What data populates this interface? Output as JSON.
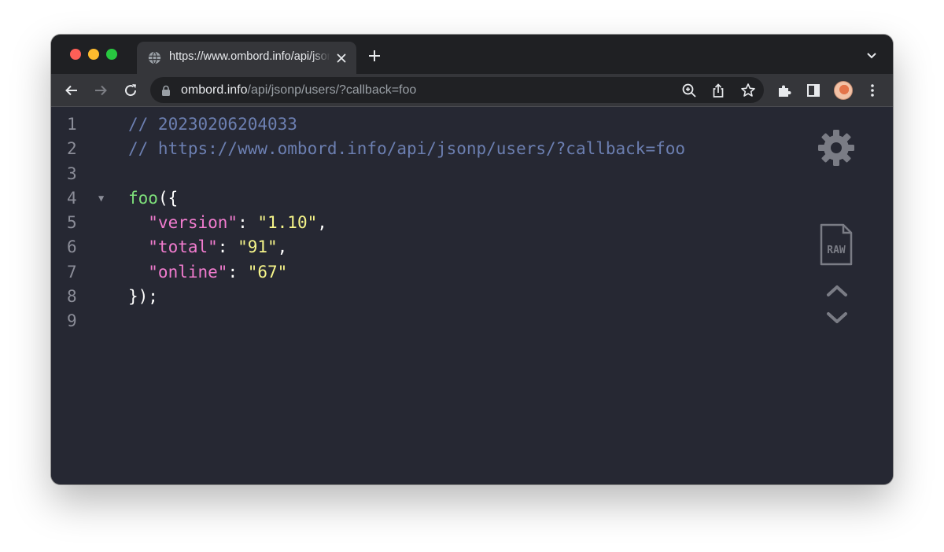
{
  "browser": {
    "tab": {
      "title": "https://www.ombord.info/api/jsonp/users/?callback=foo"
    },
    "omnibox": {
      "url_host": "ombord.info",
      "url_path": "/api/jsonp/users/?callback=foo"
    }
  },
  "viewer": {
    "lines": [
      {
        "num": "1",
        "tokens": [
          {
            "t": "// 20230206204033",
            "c": "comment"
          }
        ]
      },
      {
        "num": "2",
        "tokens": [
          {
            "t": "// https://www.ombord.info/api/jsonp/users/?callback=foo",
            "c": "comment"
          }
        ]
      },
      {
        "num": "3",
        "tokens": []
      },
      {
        "num": "4",
        "fold": "▼",
        "tokens": [
          {
            "t": "foo",
            "c": "func"
          },
          {
            "t": "({",
            "c": "punct"
          }
        ]
      },
      {
        "num": "5",
        "tokens": [
          {
            "t": "  \"version\"",
            "c": "key"
          },
          {
            "t": ": ",
            "c": "punct"
          },
          {
            "t": "\"1.10\"",
            "c": "str"
          },
          {
            "t": ",",
            "c": "punct"
          }
        ]
      },
      {
        "num": "6",
        "tokens": [
          {
            "t": "  \"total\"",
            "c": "key"
          },
          {
            "t": ": ",
            "c": "punct"
          },
          {
            "t": "\"91\"",
            "c": "str"
          },
          {
            "t": ",",
            "c": "punct"
          }
        ]
      },
      {
        "num": "7",
        "tokens": [
          {
            "t": "  \"online\"",
            "c": "key"
          },
          {
            "t": ": ",
            "c": "punct"
          },
          {
            "t": "\"67\"",
            "c": "str"
          }
        ]
      },
      {
        "num": "8",
        "tokens": [
          {
            "t": "});",
            "c": "punct"
          }
        ]
      },
      {
        "num": "9",
        "tokens": []
      }
    ],
    "raw_label": "RAW"
  },
  "icons": {
    "tab": [
      "globe-icon",
      "close-icon"
    ],
    "toolbar": [
      "back-icon",
      "forward-icon",
      "reload-icon",
      "lock-icon",
      "zoom-icon",
      "share-icon",
      "bookmark-star-icon",
      "extensions-icon",
      "side-panel-icon",
      "menu-icon"
    ],
    "viewer": [
      "settings-gear-icon",
      "raw-file-icon",
      "collapse-all-icon",
      "expand-all-icon"
    ]
  },
  "colors": {
    "comment": "#6c7fb1",
    "function": "#7ee07b",
    "key": "#f27ccf",
    "string": "#f6f58a",
    "background": "#262833"
  }
}
